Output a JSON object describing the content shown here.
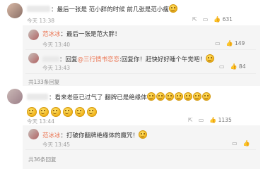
{
  "comment1": {
    "text": "：最后一张是 范小胖的时候 前几张是范小瘦",
    "time": "今天 13:38",
    "likes": "631"
  },
  "reply1": {
    "name": "范冰冰",
    "text": "：最后一张是范大胖！",
    "time": "今天 13:40",
    "likes": "149"
  },
  "reply2": {
    "prefix": "：回复",
    "mention": "@三行情书恋恋",
    "text": ":回复你！赶快好好睡个午觉吧！",
    "time": "今天 13:43",
    "likes": "84"
  },
  "thread1_more": "共133条回复",
  "comment2": {
    "text": "：看来老臣已过气了 翻牌已是绝缘体",
    "time": "今天 13:44",
    "likes": "1135"
  },
  "reply3": {
    "name": "范冰冰",
    "text": "：打破你翻牌绝缘体的魔咒！",
    "time": "今天 13:45"
  },
  "thread2_more": "共36条回复",
  "icons": [
    "forward-icon",
    "comment-icon",
    "like-icon",
    "emoji-smile-icon"
  ]
}
